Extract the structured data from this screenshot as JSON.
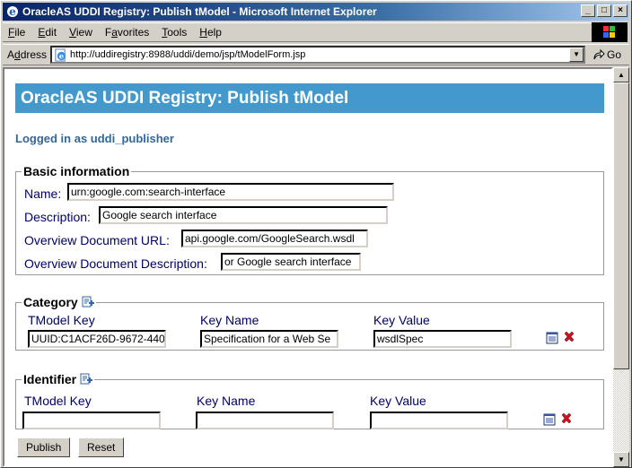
{
  "window": {
    "title": "OracleAS UDDI Registry: Publish tModel - Microsoft Internet Explorer",
    "buttons": [
      "_",
      "□",
      "×"
    ]
  },
  "menubar": {
    "items": [
      {
        "label": "File",
        "accel": "F"
      },
      {
        "label": "Edit",
        "accel": "E"
      },
      {
        "label": "View",
        "accel": "V"
      },
      {
        "label": "Favorites",
        "accel": "a"
      },
      {
        "label": "Tools",
        "accel": "T"
      },
      {
        "label": "Help",
        "accel": "H"
      }
    ]
  },
  "addressbar": {
    "label": "Address",
    "url": "http://uddiregistry:8988/uddi/demo/jsp/tModelForm.jsp",
    "go_label": "Go"
  },
  "page": {
    "header": "OracleAS UDDI Registry: Publish tModel",
    "logged_in": "Logged in as uddi_publisher",
    "basic": {
      "legend": "Basic information",
      "name_label": "Name:",
      "name_value": "urn:google.com:search-interface",
      "description_label": "Description:",
      "description_value": "Google search interface",
      "overview_url_label": "Overview Document URL:",
      "overview_url_value": "api.google.com/GoogleSearch.wsdl",
      "overview_desc_label": "Overview Document Description:",
      "overview_desc_value": "or Google search interface"
    },
    "category": {
      "legend": "Category",
      "tmodel_key_label": "TModel Key",
      "key_name_label": "Key Name",
      "key_value_label": "Key Value",
      "tmodel_key_value": "UUID:C1ACF26D-9672-440",
      "key_name_value": "Specification for a Web Se",
      "key_value_value": "wsdlSpec"
    },
    "identifier": {
      "legend": "Identifier",
      "tmodel_key_label": "TModel Key",
      "key_name_label": "Key Name",
      "key_value_label": "Key Value",
      "tmodel_key_value": "",
      "key_name_value": "",
      "key_value_value": ""
    },
    "buttons": {
      "publish": "Publish",
      "reset": "Reset"
    }
  }
}
